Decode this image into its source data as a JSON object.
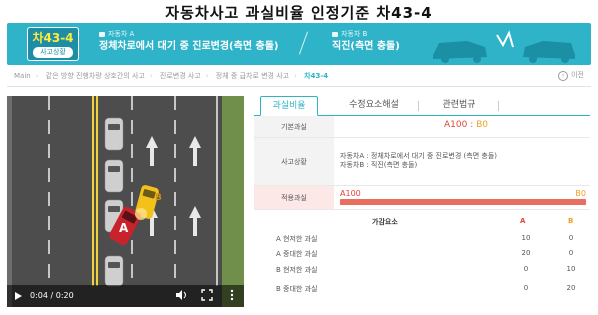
{
  "page": {
    "title": "자동차사고 과실비율 인정기준 차43-4"
  },
  "banner": {
    "code": "차43-4",
    "code_sub": "사고상황",
    "party_a_label": "자동차 A",
    "party_a_desc": "정체차로에서 대기 중 진로변경(측면 충돌)",
    "party_b_label": "자동차 B",
    "party_b_desc": "직진(측면 충돌)",
    "color": "#2fb3c9"
  },
  "breadcrumb": {
    "items": [
      "Main",
      "같은 방향 진행차량 상호간의 사고",
      "진로변경 사고",
      "정체 중 급차로 변경 사고",
      "차43-4"
    ]
  },
  "prev_button": {
    "label": "이전"
  },
  "video": {
    "time": "0:04 / 0:20",
    "progress": 0.2
  },
  "tabs": [
    "과실비율",
    "수정요소해설",
    "관련법규"
  ],
  "basic_ratio": {
    "label": "기본과실",
    "a": "A100",
    "b": "B0"
  },
  "situation": {
    "label": "사고상황",
    "line1": "자동차A : 정체차로에서 대기 중 진로변경 (측면 충돌)",
    "line2": "자동차B : 직진(측면 충돌)"
  },
  "applied": {
    "label": "적용과실",
    "a": "A100",
    "b": "B0",
    "a_percent": 100
  },
  "factors": {
    "title": "가감요소",
    "col_a": "A",
    "col_b": "B",
    "rows": [
      {
        "name": "A 현저한 과실",
        "a": "10",
        "b": "0"
      },
      {
        "name": "A 중대한 과실",
        "a": "20",
        "b": "0"
      },
      {
        "name": "B 현저한 과실",
        "a": "0",
        "b": "10"
      },
      {
        "name": "B 중대한 과실",
        "a": "0",
        "b": "20"
      }
    ]
  },
  "colors": {
    "party_a": "#e0453a",
    "party_b": "#f0a020"
  }
}
